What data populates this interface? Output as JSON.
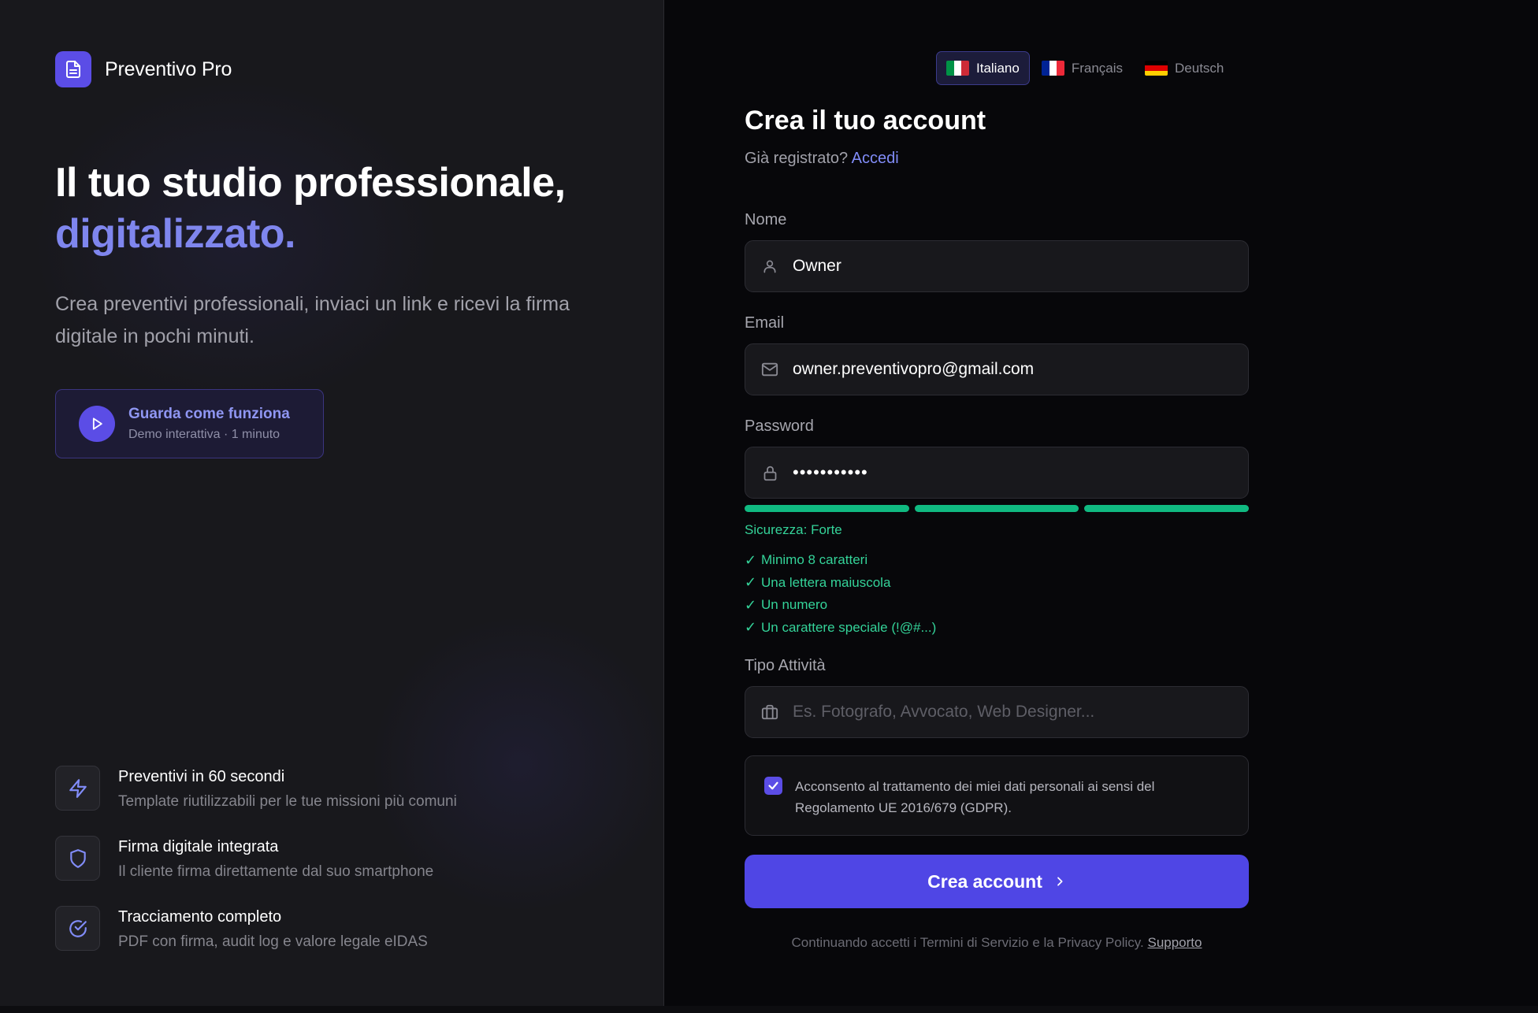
{
  "brand": {
    "name": "Preventivo Pro",
    "logo_icon": "document-icon"
  },
  "hero": {
    "title_line1": "Il tuo studio professionale,",
    "title_line2": "digitalizzato.",
    "subtitle": "Crea preventivi professionali, inviaci un link e ricevi la firma digitale in pochi minuti.",
    "accent_color": "#7f86ee"
  },
  "demo": {
    "title": "Guarda come funziona",
    "subtitle": "Demo interattiva · 1 minuto",
    "icon": "play-icon"
  },
  "features": [
    {
      "icon": "lightning-icon",
      "title": "Preventivi in 60 secondi",
      "subtitle": "Template riutilizzabili per le tue missioni più comuni"
    },
    {
      "icon": "shield-icon",
      "title": "Firma digitale integrata",
      "subtitle": "Il cliente firma direttamente dal suo smartphone"
    },
    {
      "icon": "check-circle-icon",
      "title": "Tracciamento completo",
      "subtitle": "PDF con firma, audit log e valore legale eIDAS"
    }
  ],
  "languages": [
    {
      "label": "Italiano",
      "active": true
    },
    {
      "label": "Français",
      "active": false
    },
    {
      "label": "Deutsch",
      "active": false
    }
  ],
  "form": {
    "title": "Crea il tuo account",
    "login_prompt": "Già registrato?",
    "login_link": "Accedi",
    "name": {
      "label": "Nome",
      "value": "Owner",
      "icon": "user-icon"
    },
    "email": {
      "label": "Email",
      "value": "owner.preventivopro@gmail.com",
      "icon": "mail-icon"
    },
    "password": {
      "label": "Password",
      "value_masked": "•••••••••••",
      "icon": "lock-icon",
      "strength_segments_filled": 3,
      "strength_segments_total": 3,
      "strength_label": "Sicurezza: Forte",
      "strength_color": "#10b981",
      "rules": [
        "Minimo 8 caratteri",
        "Una lettera maiuscola",
        "Un numero",
        "Un carattere speciale (!@#...)"
      ]
    },
    "activity": {
      "label": "Tipo Attività",
      "placeholder": "Es. Fotografo, Avvocato, Web Designer...",
      "icon": "briefcase-icon"
    },
    "consent": {
      "checked": true,
      "text": "Acconsento al trattamento dei miei dati personali ai sensi del Regolamento UE 2016/679 (GDPR)."
    },
    "submit_label": "Crea account",
    "primary_color": "#4f46e5",
    "terms_text": "Continuando accetti i Termini di Servizio e la Privacy Policy.",
    "support_link": "Supporto"
  }
}
